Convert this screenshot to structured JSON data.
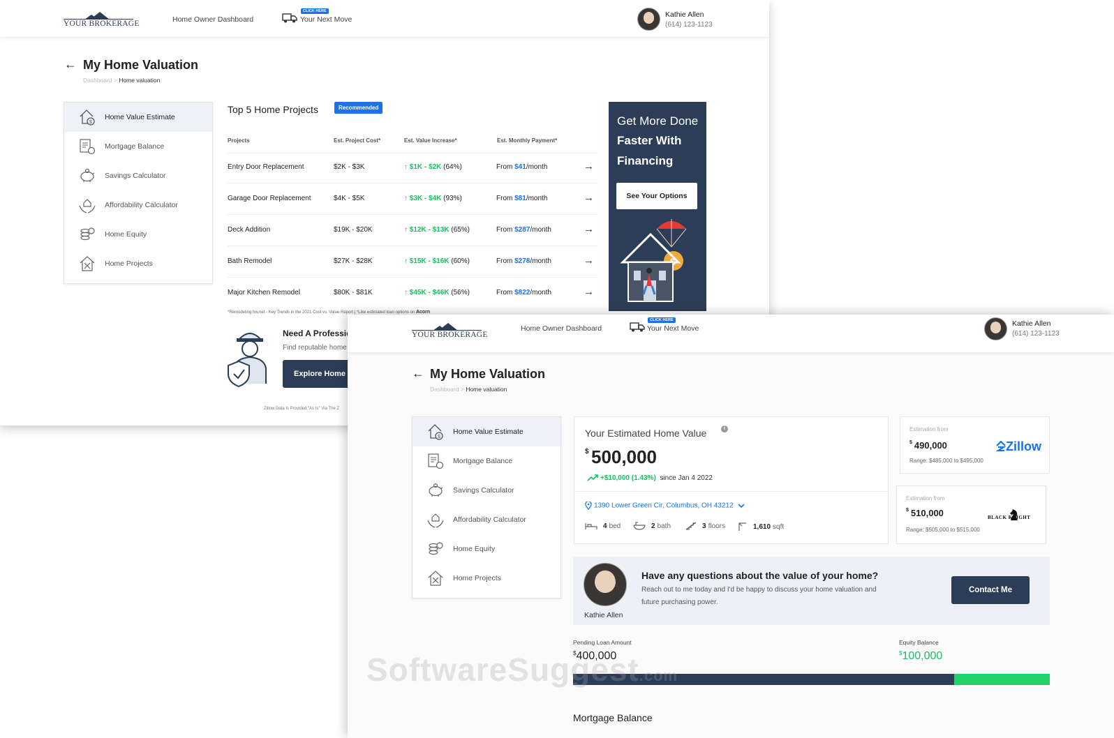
{
  "brand": "YOUR BROKERAGE",
  "nav": {
    "dashboard": "Home Owner Dashboard",
    "click_here": "CLICK HERE",
    "next_move": "Your Next Move"
  },
  "user": {
    "name": "Kathie Allen",
    "phone": "(614) 123-1123"
  },
  "page": {
    "title": "My Home Valuation",
    "crumb_root": "Dashboard",
    "crumb_sep": ">",
    "crumb_current": "Home valuation"
  },
  "sidebar": {
    "items": [
      {
        "label": "Home Value Estimate",
        "icon": "house-dollar-icon"
      },
      {
        "label": "Mortgage Balance",
        "icon": "document-coin-icon"
      },
      {
        "label": "Savings Calculator",
        "icon": "piggy-bank-icon"
      },
      {
        "label": "Affordability Calculator",
        "icon": "hands-house-icon"
      },
      {
        "label": "Home Equity",
        "icon": "coin-stack-icon"
      },
      {
        "label": "Home Projects",
        "icon": "house-tools-icon"
      }
    ]
  },
  "projects": {
    "title": "Top 5 Home Projects",
    "badge": "Recommended",
    "headers": [
      "Projects",
      "Est. Project Cost*",
      "Est. Value Increase*",
      "Est. Monthly Payment*"
    ],
    "rows": [
      {
        "name": "Entry Door Replacement",
        "cost": "$2K - $3K",
        "increase": "$1K - $2K",
        "pct": "(64%)",
        "from": "From",
        "payment": "$41",
        "per": "/month"
      },
      {
        "name": "Garage Door Replacement",
        "cost": "$4K - $5K",
        "increase": "$3K - $4K",
        "pct": "(93%)",
        "from": "From",
        "payment": "$81",
        "per": "/month"
      },
      {
        "name": "Deck Addition",
        "cost": "$19K - $20K",
        "increase": "$12K - $13K",
        "pct": "(65%)",
        "from": "From",
        "payment": "$287",
        "per": "/month"
      },
      {
        "name": "Bath Remodel",
        "cost": "$27K - $28K",
        "increase": "$15K - $16K",
        "pct": "(60%)",
        "from": "From",
        "payment": "$278",
        "per": "/month"
      },
      {
        "name": "Major Kitchen Remodel",
        "cost": "$80K - $81K",
        "increase": "$45K - $46K",
        "pct": "(56%)",
        "from": "From",
        "payment": "$822",
        "per": "/month"
      }
    ],
    "footnote": "*Remodeling hw.net - Key Trends in the 2021 Cost vs. Value Report  |  *Like estimated loan options on",
    "footnote_brand": "Acorn"
  },
  "financing": {
    "line1": "Get More Done",
    "line2": "Faster With",
    "line3": "Financing",
    "button": "See Your Options"
  },
  "pro": {
    "title": "Need A Professio",
    "subtitle": "Find reputable home",
    "button": "Explore Home",
    "disclaimer": "Zillow Data Is Provided \"As Is\" Via The Z"
  },
  "estimate": {
    "title": "Your Estimated Home Value",
    "info": "i",
    "currency": "$",
    "value": "500,000",
    "change": "+$10,000 (1.43%)",
    "since": "since Jan 4 2022",
    "address": "1390 Lower Green Cir, Columbus, OH 43212",
    "beds_num": "4",
    "beds_unit": "bed",
    "baths_num": "2",
    "baths_unit": "bath",
    "floors_num": "3",
    "floors_unit": "floors",
    "sqft_num": "1,610",
    "sqft_unit": "sqft"
  },
  "sources": [
    {
      "label": "Estimation from",
      "currency": "$",
      "value": "490,000",
      "range": "Range: $485,000 to $495,000",
      "brand": "Zillow"
    },
    {
      "label": "Estimation from",
      "currency": "$",
      "value": "510,000",
      "range": "Range: $505,000 to $515,000",
      "brand": "BLACK KNIGHT"
    }
  ],
  "question": {
    "title": "Have any questions about the value of your home?",
    "text": "Reach out to me today and I'd be happy to discuss your home valuation and future purchasing power.",
    "button": "Contact Me",
    "agent": "Kathie Allen"
  },
  "loan": {
    "pending_label": "Pending Loan Amount",
    "currency": "$",
    "pending_value": "400,000",
    "equity_label": "Equity Balance",
    "equity_value": "100,000",
    "equity_fraction": 0.2
  },
  "mortgage_title": "Mortgage Balance",
  "watermark": "SoftwareSuggest",
  "watermark_suffix": ".com",
  "colors": {
    "navy": "#2c3e57",
    "accent_blue": "#1a73e8",
    "green": "#16c15f",
    "equity_green": "#22d36a"
  }
}
